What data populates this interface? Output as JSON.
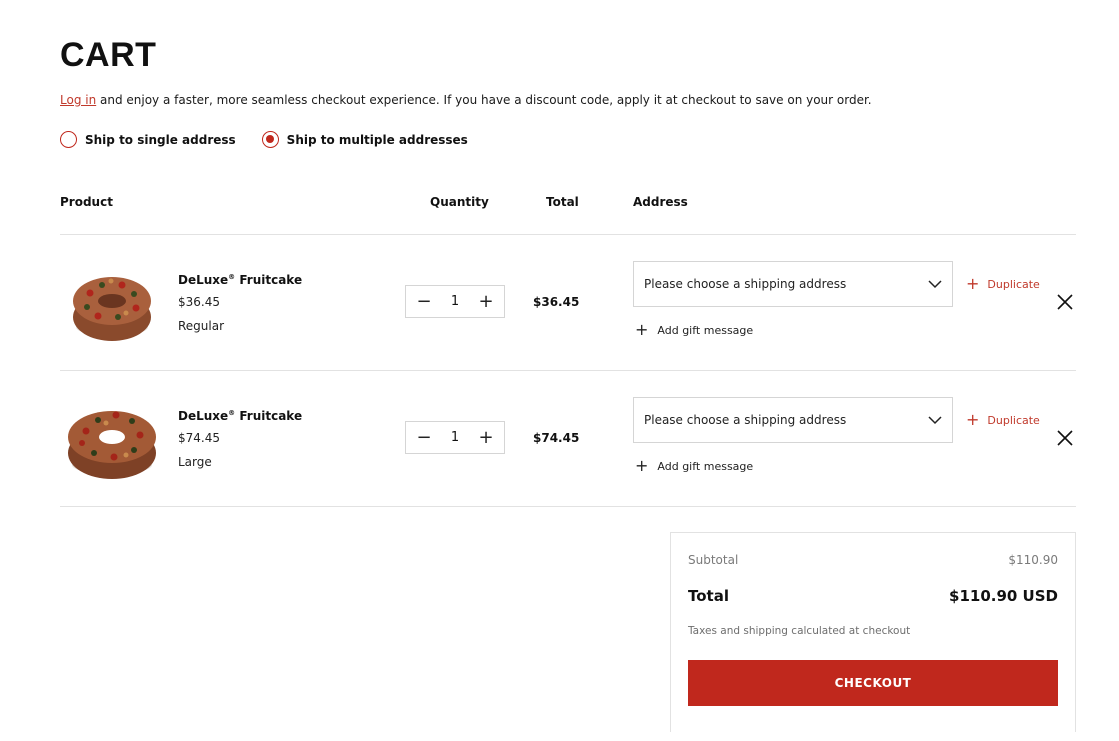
{
  "page": {
    "title": "CART"
  },
  "intro": {
    "login_link": "Log in",
    "message": " and enjoy a faster, more seamless checkout experience. If you have a discount code, apply it at checkout to save on your order."
  },
  "shipping_options": [
    {
      "label": "Ship to single address",
      "selected": false
    },
    {
      "label": "Ship to multiple addresses",
      "selected": true
    }
  ],
  "table_headers": {
    "product": "Product",
    "quantity": "Quantity",
    "total": "Total",
    "address": "Address"
  },
  "items": [
    {
      "name": "DeLuxe",
      "registered": "®",
      "name_suffix": " Fruitcake",
      "price": "$36.45",
      "variant": "Regular",
      "quantity": "1",
      "total": "$36.45",
      "address_placeholder": "Please choose a shipping address",
      "duplicate_label": "Duplicate",
      "gift_label": "Add gift message",
      "image_icon": "fruitcake-regular-image"
    },
    {
      "name": "DeLuxe",
      "registered": "®",
      "name_suffix": " Fruitcake",
      "price": "$74.45",
      "variant": "Large",
      "quantity": "1",
      "total": "$74.45",
      "address_placeholder": "Please choose a shipping address",
      "duplicate_label": "Duplicate",
      "gift_label": "Add gift message",
      "image_icon": "fruitcake-large-image"
    }
  ],
  "summary": {
    "subtotal_label": "Subtotal",
    "subtotal_value": "$110.90",
    "total_label": "Total",
    "total_value": "$110.90 USD",
    "tax_note": "Taxes and shipping calculated at checkout",
    "checkout_label": "CHECKOUT"
  },
  "colors": {
    "accent": "#c0281d",
    "border": "#d5d5d5",
    "divider": "#e2e2e2"
  }
}
